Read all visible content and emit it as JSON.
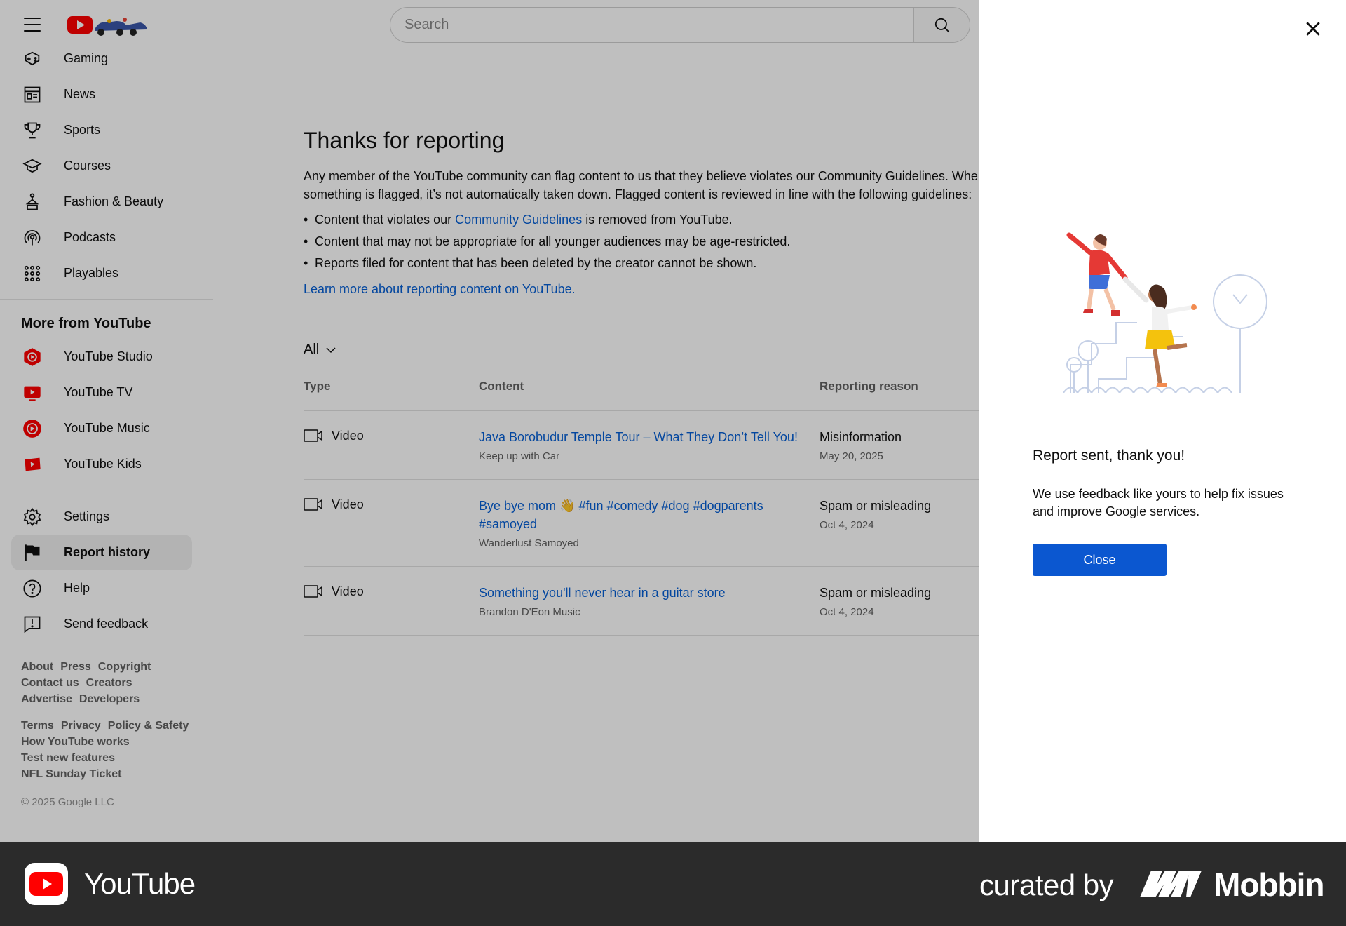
{
  "search": {
    "placeholder": "Search"
  },
  "sidebar": {
    "explore_items": [
      {
        "label": "Gaming",
        "icon": "gaming-icon"
      },
      {
        "label": "News",
        "icon": "news-icon"
      },
      {
        "label": "Sports",
        "icon": "trophy-icon"
      },
      {
        "label": "Courses",
        "icon": "courses-icon"
      },
      {
        "label": "Fashion & Beauty",
        "icon": "hanger-icon"
      },
      {
        "label": "Podcasts",
        "icon": "podcast-icon"
      },
      {
        "label": "Playables",
        "icon": "playables-icon"
      }
    ],
    "more_heading": "More from YouTube",
    "more_items": [
      {
        "label": "YouTube Studio",
        "icon": "youtube-studio-icon"
      },
      {
        "label": "YouTube TV",
        "icon": "youtube-tv-icon"
      },
      {
        "label": "YouTube Music",
        "icon": "youtube-music-icon"
      },
      {
        "label": "YouTube Kids",
        "icon": "youtube-kids-icon"
      }
    ],
    "settings_items": [
      {
        "label": "Settings",
        "icon": "gear-icon"
      },
      {
        "label": "Report history",
        "icon": "flag-icon",
        "active": true
      },
      {
        "label": "Help",
        "icon": "help-icon"
      },
      {
        "label": "Send feedback",
        "icon": "feedback-icon"
      }
    ],
    "footer_primary": [
      "About",
      "Press",
      "Copyright",
      "Contact us",
      "Creators",
      "Advertise",
      "Developers"
    ],
    "footer_secondary": [
      "Terms",
      "Privacy",
      "Policy & Safety",
      "How YouTube works",
      "Test new features",
      "NFL Sunday Ticket"
    ],
    "copyright": "© 2025 Google LLC"
  },
  "main": {
    "title": "Thanks for reporting",
    "intro": "Any member of the YouTube community can flag content to us that they believe violates our Community Guidelines. When something is flagged, it’s not automatically taken down. Flagged content is reviewed in line with the following guidelines:",
    "bullet1_pre": "Content that violates our ",
    "bullet1_link": "Community Guidelines",
    "bullet1_post": " is removed from YouTube.",
    "bullet2": "Content that may not be appropriate for all younger audiences may be age-restricted.",
    "bullet3": "Reports filed for content that has been deleted by the creator cannot be shown.",
    "learn_more": "Learn more about reporting content on YouTube.",
    "filter_label": "All",
    "columns": {
      "type": "Type",
      "content": "Content",
      "reason": "Reporting reason"
    },
    "rows": [
      {
        "type": "Video",
        "title": "Java Borobudur Temple Tour – What They Don’t Tell You!",
        "channel": "Keep up with Car",
        "reason": "Misinformation",
        "date": "May 20, 2025"
      },
      {
        "type": "Video",
        "title": "Bye bye mom 👋 #fun #comedy #dog #dogparents #samoyed",
        "channel": "Wanderlust Samoyed",
        "reason": "Spam or misleading",
        "date": "Oct 4, 2024"
      },
      {
        "type": "Video",
        "title": "Something you'll never hear in a guitar store",
        "channel": "Brandon D'Eon Music",
        "reason": "Spam or misleading",
        "date": "Oct 4, 2024"
      }
    ]
  },
  "panel": {
    "title": "Report sent, thank you!",
    "text": "We use feedback like yours to help fix issues and improve Google services.",
    "close_label": "Close"
  },
  "brandbar": {
    "app_name": "YouTube",
    "curated_by": "curated by",
    "curator": "Mobbin"
  },
  "colors": {
    "link": "#065fd4",
    "button": "#0b57d0",
    "brand_red": "#ff0000",
    "brandbar_bg": "#2b2b2b"
  }
}
